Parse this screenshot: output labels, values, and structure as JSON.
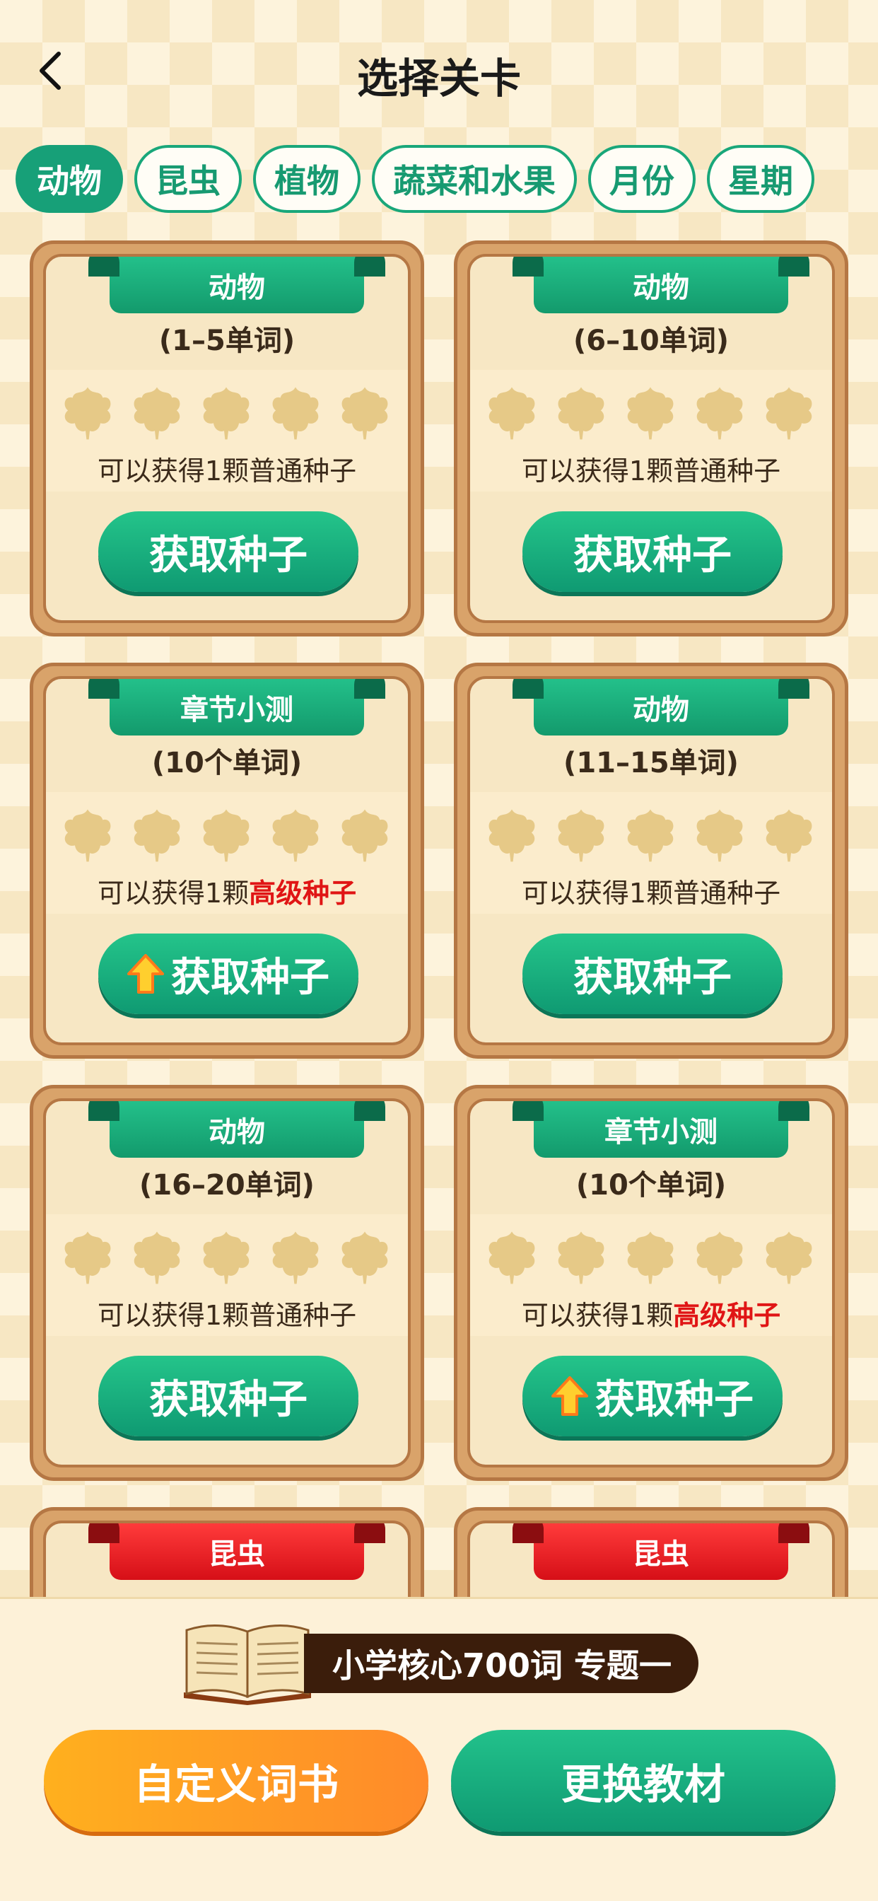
{
  "header": {
    "title": "选择关卡"
  },
  "tabs": [
    {
      "label": "动物",
      "active": true
    },
    {
      "label": "昆虫"
    },
    {
      "label": "植物"
    },
    {
      "label": "蔬菜和水果"
    },
    {
      "label": "月份"
    },
    {
      "label": "星期"
    }
  ],
  "cards": [
    {
      "title": "动物",
      "range": "(1–5单词)",
      "reward_prefix": "可以获得1颗",
      "reward_seed": "普通种子",
      "button": "获取种子"
    },
    {
      "title": "动物",
      "range": "(6–10单词)",
      "reward_prefix": "可以获得1颗",
      "reward_seed": "普通种子",
      "button": "获取种子"
    },
    {
      "title": "章节小测",
      "range": "(10个单词)",
      "reward_prefix": "可以获得1颗",
      "reward_seed": "高级种子",
      "button": "获取种子"
    },
    {
      "title": "动物",
      "range": "(11–15单词)",
      "reward_prefix": "可以获得1颗",
      "reward_seed": "普通种子",
      "button": "获取种子"
    },
    {
      "title": "动物",
      "range": "(16–20单词)",
      "reward_prefix": "可以获得1颗",
      "reward_seed": "普通种子",
      "button": "获取种子"
    },
    {
      "title": "章节小测",
      "range": "(10个单词)",
      "reward_prefix": "可以获得1颗",
      "reward_seed": "高级种子",
      "button": "获取种子"
    },
    {
      "title": "昆虫"
    },
    {
      "title": "昆虫"
    }
  ],
  "bottom": {
    "topic": "小学核心700词 专题一",
    "custom_button": "自定义词书",
    "change_button": "更换教材"
  },
  "colors": {
    "primary_green": "#17a078",
    "ribbon_red": "#e01b1b",
    "orange": "#ff9a24",
    "highlight_red": "#e01515"
  }
}
